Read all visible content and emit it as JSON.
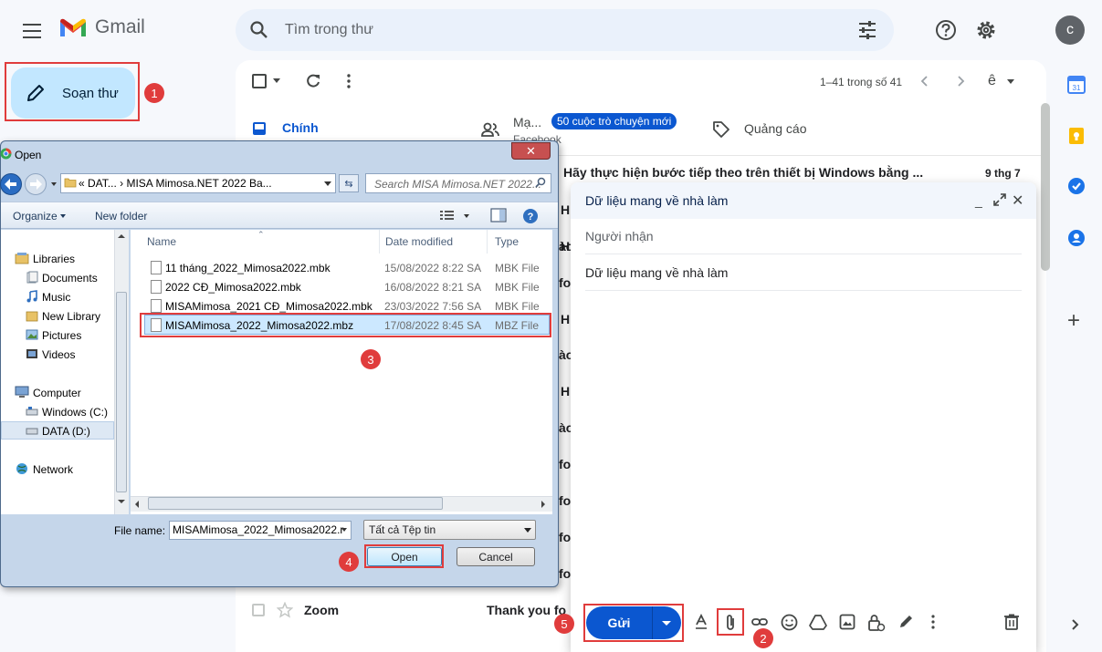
{
  "gmail": {
    "brand": "Gmail",
    "search_placeholder": "Tìm trong thư",
    "avatar_letter": "c",
    "compose_label": "Soạn thư",
    "pager": "1–41 trong số 41",
    "lang_glyph": "ê",
    "tabs": {
      "primary": "Chính",
      "social": "Mạ...",
      "social_sub": "Facebook",
      "social_chip": "50 cuộc trò chuyện mới",
      "promotions": "Quảng cáo"
    },
    "first_mail": {
      "subject": "Hãy thực hiện bước tiếp theo trên thiết bị Windows bằng ...",
      "date": "9 thg 7"
    },
    "row_stubs": [
      "H",
      "H",
      "ào",
      "fo",
      "H",
      "ào",
      "H",
      "ào",
      "fo",
      "fo",
      "fo",
      "fo"
    ],
    "last_mail": {
      "sender": "Zoom",
      "snippet": "Thank you fo"
    }
  },
  "compose_window": {
    "title": "Dữ liệu mang về nhà làm",
    "minimize": "_",
    "close": "✕",
    "recipients_placeholder": "Người nhận",
    "subject": "Dữ liệu mang về nhà làm",
    "send_label": "Gửi",
    "toolbar_icons": [
      "format-text-icon",
      "attach-icon",
      "link-icon",
      "emoji-icon",
      "drive-icon",
      "photo-icon",
      "confidential-icon",
      "signature-icon",
      "more-options-icon",
      "trash-icon"
    ]
  },
  "side_panel": {
    "calendar_day": "31",
    "add": "+"
  },
  "open_dialog": {
    "title": "Open",
    "close": "✕",
    "address_path": "«  DAT...  ›  MISA Mimosa.NET 2022 Ba...",
    "search_placeholder": "Search MISA Mimosa.NET 2022...",
    "organize": "Organize",
    "new_folder": "New folder",
    "nav": {
      "libraries": "Libraries",
      "documents": "Documents",
      "music": "Music",
      "new_library": "New Library",
      "pictures": "Pictures",
      "videos": "Videos",
      "computer": "Computer",
      "windows_c": "Windows (C:)",
      "data_d": "DATA (D:)",
      "network": "Network"
    },
    "columns": {
      "name": "Name",
      "date": "Date modified",
      "type": "Type"
    },
    "files": [
      {
        "name": "11 tháng_2022_Mimosa2022.mbk",
        "date": "15/08/2022 8:22 SA",
        "type": "MBK File"
      },
      {
        "name": "2022 CĐ_Mimosa2022.mbk",
        "date": "16/08/2022 8:21 SA",
        "type": "MBK File"
      },
      {
        "name": "MISAMimosa_2021 CĐ_Mimosa2022.mbk",
        "date": "23/03/2022 7:56 SA",
        "type": "MBK File"
      },
      {
        "name": "MISAMimosa_2022_Mimosa2022.mbz",
        "date": "17/08/2022 8:45 SA",
        "type": "MBZ File"
      }
    ],
    "file_name_label": "File name:",
    "file_name_value": "MISAMimosa_2022_Mimosa2022.r",
    "file_type": "Tất cả Tệp tin",
    "open_button": "Open",
    "cancel_button": "Cancel"
  },
  "step_badges": [
    "1",
    "2",
    "3",
    "4",
    "5"
  ],
  "colors": {
    "annotation_red": "#e03c3c",
    "gmail_blue": "#0b57d0",
    "compose_bg": "#c2e7ff"
  }
}
